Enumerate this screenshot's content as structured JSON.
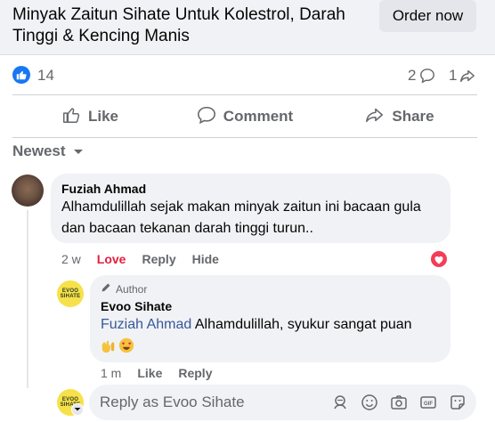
{
  "ad": {
    "title": "Minyak Zaitun Sihate Untuk Kolestrol, Darah Tinggi & Kencing Manis",
    "cta_label": "Order now"
  },
  "stats": {
    "like_count": "14",
    "comment_count": "2",
    "share_count": "1"
  },
  "actions": {
    "like_label": "Like",
    "comment_label": "Comment",
    "share_label": "Share"
  },
  "sort": {
    "label": "Newest"
  },
  "comments": [
    {
      "author": "Fuziah Ahmad",
      "text": "Alhamdulillah sejak makan minyak zaitun ini bacaan gula dan bacaan tekanan darah tinggi turun..",
      "time": "2 w",
      "reaction_label": "Love",
      "reply_label": "Reply",
      "hide_label": "Hide",
      "reaction_icon": "heart-icon"
    }
  ],
  "reply": {
    "author_tag": "Author",
    "author": "Evoo Sihate",
    "mention": "Fuziah Ahmad",
    "text": "Alhamdulillah, syukur sangat puan",
    "emojis": [
      "hands-emoji",
      "heart-eyes-emoji"
    ],
    "time": "1 m",
    "like_label": "Like",
    "reply_label": "Reply"
  },
  "logo": {
    "line1": "EVOO",
    "line2": "SIHATE"
  },
  "composer": {
    "placeholder": "Reply as Evoo Sihate"
  },
  "colors": {
    "accent": "#1877f2",
    "love": "#e41e3f",
    "mention": "#385898",
    "bubble": "#f0f2f5",
    "logo_bg": "#f7e14a"
  }
}
